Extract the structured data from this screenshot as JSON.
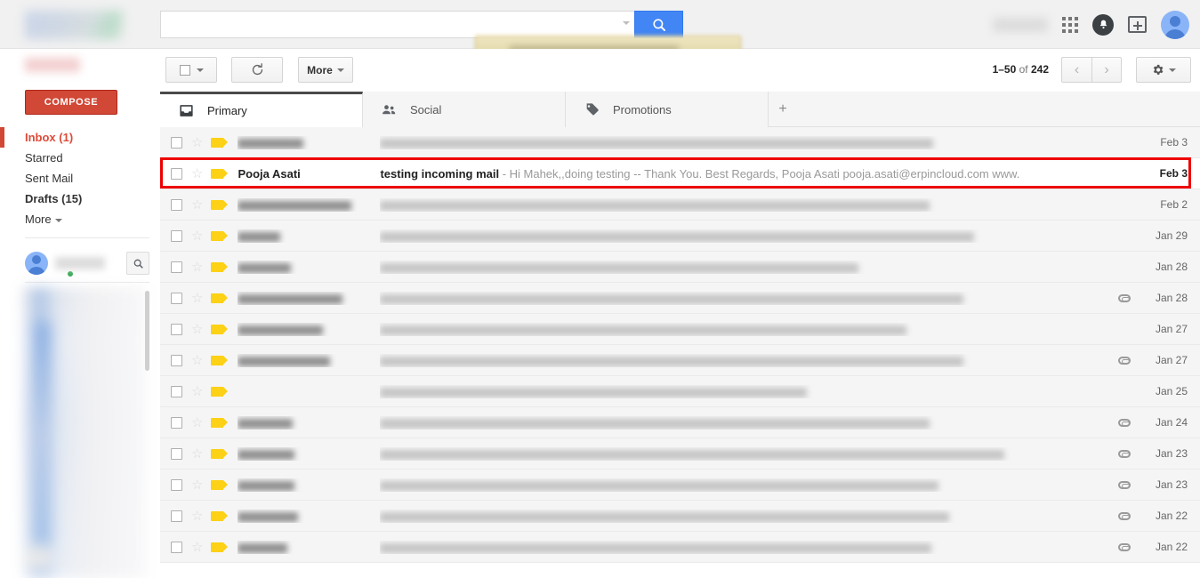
{
  "header": {
    "search_value": "",
    "search_placeholder": "",
    "search_icon": "search-icon",
    "apps_icon": "apps-grid-icon",
    "bell_icon": "notifications-bell-icon",
    "share_icon": "add-to-box-icon",
    "avatar_icon": "user-avatar-icon",
    "tooltip_text": ""
  },
  "sidebar": {
    "compose_label": "COMPOSE",
    "items": [
      {
        "label": "Inbox (1)",
        "state": "active"
      },
      {
        "label": "Starred",
        "state": "normal"
      },
      {
        "label": "Sent Mail",
        "state": "normal"
      },
      {
        "label": "Drafts (15)",
        "state": "bold"
      },
      {
        "label": "More",
        "state": "more"
      }
    ],
    "chat_search_icon": "chat-search-icon"
  },
  "toolbar": {
    "select_label": "",
    "refresh_label": "",
    "refresh_icon": "refresh-icon",
    "more_label": "More",
    "pager_prefix": "1–50",
    "pager_mid": " of ",
    "pager_total": "242",
    "prev_label": "‹",
    "next_label": "›",
    "gear_icon": "settings-gear-icon"
  },
  "tabs": [
    {
      "label": "Primary",
      "icon": "inbox-tray-icon",
      "active": true
    },
    {
      "label": "Social",
      "icon": "people-icon",
      "active": false
    },
    {
      "label": "Promotions",
      "icon": "price-tag-icon",
      "active": false
    }
  ],
  "tab_add_label": "+",
  "colors": {
    "brand_red": "#d14836",
    "accent_blue": "#4285f4",
    "label_yellow": "#fcd116",
    "annotation_red": "#ee0000",
    "inbox_active": "#dd4b39"
  },
  "emails": [
    {
      "sender": "",
      "subject": "",
      "snippet": "",
      "date": "Feb 3",
      "unread": false,
      "attachment": false,
      "redacted": true,
      "highlighted": false,
      "blur_sender_w": 74,
      "blur_subject_w": 622
    },
    {
      "sender": "Pooja Asati",
      "subject": "testing incoming mail",
      "snippet": " - Hi Mahek,,doing testing -- Thank You. Best Regards, Pooja Asati pooja.asati@erpincloud.com www.",
      "date": "Feb 3",
      "unread": true,
      "attachment": false,
      "redacted": false,
      "highlighted": true
    },
    {
      "sender": "",
      "subject": "",
      "snippet": "",
      "date": "Feb 2",
      "unread": false,
      "attachment": false,
      "redacted": true,
      "highlighted": false,
      "blur_sender_w": 128,
      "blur_subject_w": 618
    },
    {
      "sender": "",
      "subject": "",
      "snippet": "",
      "date": "Jan 29",
      "unread": false,
      "attachment": false,
      "redacted": true,
      "highlighted": false,
      "blur_sender_w": 48,
      "blur_subject_w": 668
    },
    {
      "sender": "",
      "subject": "",
      "snippet": "",
      "date": "Jan 28",
      "unread": false,
      "attachment": false,
      "redacted": true,
      "highlighted": false,
      "blur_sender_w": 60,
      "blur_subject_w": 538
    },
    {
      "sender": "",
      "subject": "",
      "snippet": "",
      "date": "Jan 28",
      "unread": false,
      "attachment": true,
      "redacted": true,
      "highlighted": false,
      "blur_sender_w": 118,
      "blur_subject_w": 656
    },
    {
      "sender": "",
      "subject": "",
      "snippet": "",
      "date": "Jan 27",
      "unread": false,
      "attachment": false,
      "redacted": true,
      "highlighted": false,
      "blur_sender_w": 96,
      "blur_subject_w": 592
    },
    {
      "sender": "",
      "subject": "",
      "snippet": "",
      "date": "Jan 27",
      "unread": false,
      "attachment": true,
      "redacted": true,
      "highlighted": false,
      "blur_sender_w": 104,
      "blur_subject_w": 656
    },
    {
      "sender": "",
      "subject": "",
      "snippet": "",
      "date": "Jan 25",
      "unread": false,
      "attachment": false,
      "redacted": true,
      "highlighted": false,
      "blur_sender_w": 0,
      "blur_subject_w": 480
    },
    {
      "sender": "",
      "subject": "",
      "snippet": "",
      "date": "Jan 24",
      "unread": false,
      "attachment": true,
      "redacted": true,
      "highlighted": false,
      "blur_sender_w": 62,
      "blur_subject_w": 618
    },
    {
      "sender": "",
      "subject": "",
      "snippet": "",
      "date": "Jan 23",
      "unread": false,
      "attachment": true,
      "redacted": true,
      "highlighted": false,
      "blur_sender_w": 64,
      "blur_subject_w": 702
    },
    {
      "sender": "",
      "subject": "",
      "snippet": "",
      "date": "Jan 23",
      "unread": false,
      "attachment": true,
      "redacted": true,
      "highlighted": false,
      "blur_sender_w": 64,
      "blur_subject_w": 628
    },
    {
      "sender": "",
      "subject": "",
      "snippet": "",
      "date": "Jan 22",
      "unread": false,
      "attachment": true,
      "redacted": true,
      "highlighted": false,
      "blur_sender_w": 68,
      "blur_subject_w": 640
    },
    {
      "sender": "",
      "subject": "",
      "snippet": "",
      "date": "Jan 22",
      "unread": false,
      "attachment": true,
      "redacted": true,
      "highlighted": false,
      "blur_sender_w": 56,
      "blur_subject_w": 620
    }
  ]
}
